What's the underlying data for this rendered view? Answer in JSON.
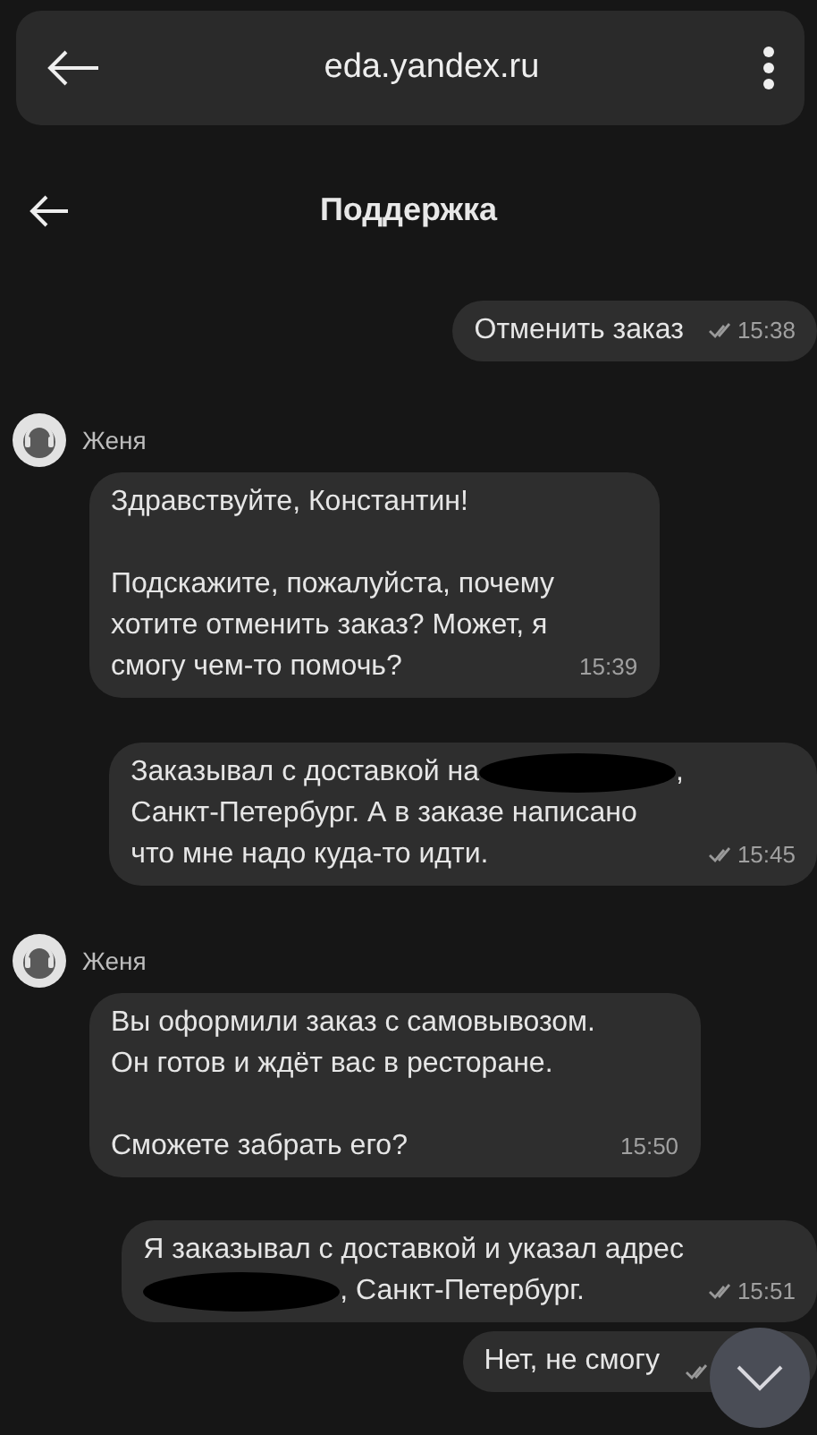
{
  "browser_bar": {
    "url": "eda.yandex.ru"
  },
  "header": {
    "title": "Поддержка"
  },
  "messages": [
    {
      "kind": "outgoing",
      "parts": [
        {
          "kind": "text",
          "text": "Отменить заказ"
        }
      ],
      "time": "15:38",
      "read": true
    },
    {
      "kind": "incoming",
      "sender": "Женя",
      "parts": [
        {
          "kind": "text",
          "text": "Здравствуйте, Константин!\n\nПодскажите, пожалуйста, почему\nхотите отменить заказ? Может, я\nсмогу чем-то помочь?"
        }
      ],
      "time": "15:39"
    },
    {
      "kind": "outgoing",
      "parts": [
        {
          "kind": "text",
          "text": "Заказывал с доставкой на"
        },
        {
          "kind": "redaction"
        },
        {
          "kind": "text",
          "text": ",\nСанкт-Петербург. А в заказе написано\nчто мне надо куда-то идти."
        }
      ],
      "time": "15:45",
      "read": true
    },
    {
      "kind": "incoming",
      "sender": "Женя",
      "parts": [
        {
          "kind": "text",
          "text": "Вы оформили заказ с самовывозом.\nОн готов и ждёт вас в ресторане.\n\nСможете забрать его?"
        }
      ],
      "time": "15:50"
    },
    {
      "kind": "outgoing",
      "parts": [
        {
          "kind": "text",
          "text": "Я заказывал с доставкой и указал адрес\n"
        },
        {
          "kind": "redaction"
        },
        {
          "kind": "text",
          "text": ", Санкт-Петербург."
        }
      ],
      "time": "15:51",
      "read": true
    },
    {
      "kind": "outgoing",
      "parts": [
        {
          "kind": "text",
          "text": "Нет, не смогу"
        }
      ],
      "read": true
    }
  ]
}
